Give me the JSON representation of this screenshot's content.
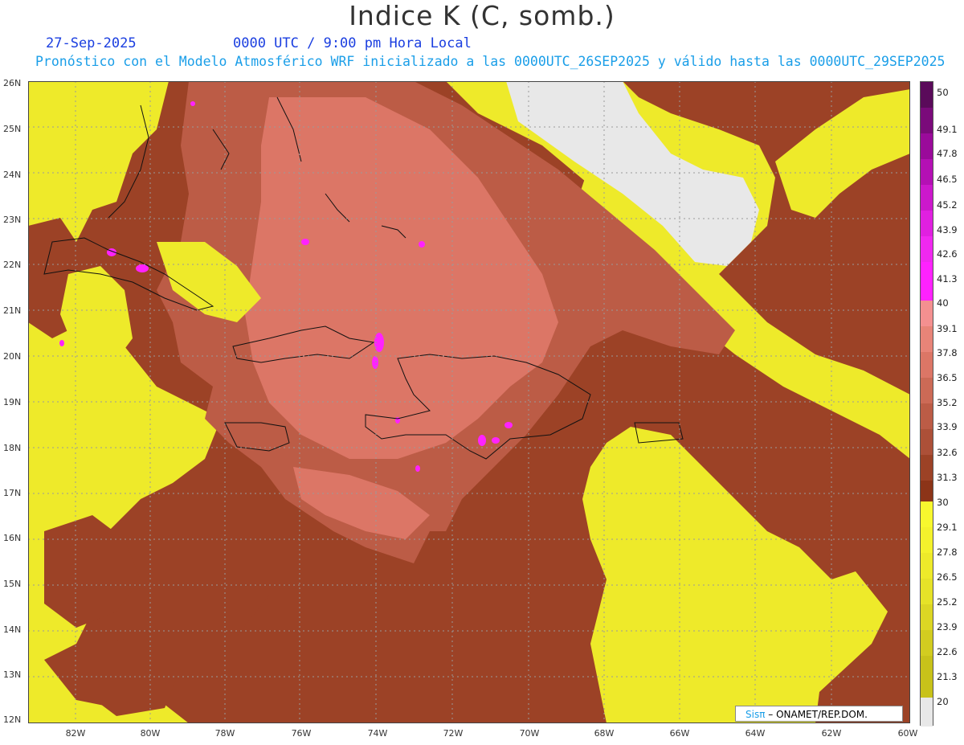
{
  "header": {
    "title": "Indice K (C, somb.)",
    "date": "27-Sep-2025",
    "time": "0000 UTC / 9:00 pm Hora Local",
    "subtitle": "Pronóstico con el Modelo Atmosférico WRF inicializado a las 0000UTC_26SEP2025 y válido hasta las  0000UTC_29SEP2025"
  },
  "colors": {
    "c20": "#e8e8e8",
    "c21": "#c8c21a",
    "c22": "#d2cc20",
    "c24": "#dcd624",
    "c25": "#e6e228",
    "c26": "#eeea2a",
    "c28": "#f4f22c",
    "c29": "#f8f82e",
    "c30": "#8c3418",
    "c31": "#9c4226",
    "c33": "#ac5038",
    "c34": "#bc5c46",
    "c35": "#cc6a56",
    "c36": "#dc7666",
    "c38": "#e88478",
    "c39": "#f49090",
    "magenta": "#ff22ff",
    "land_outline": "#111111",
    "grid": "#9a9a9a"
  },
  "colorbar": {
    "labels": [
      "50",
      "49.1",
      "47.8",
      "46.5",
      "45.2",
      "43.9",
      "42.6",
      "41.3",
      "40",
      "39.1",
      "37.8",
      "36.5",
      "35.2",
      "33.9",
      "32.6",
      "31.3",
      "30",
      "29.1",
      "27.8",
      "26.5",
      "25.2",
      "23.9",
      "22.6",
      "21.3",
      "20"
    ]
  },
  "axes": {
    "lat_labels": [
      "26N",
      "25N",
      "24N",
      "23N",
      "22N",
      "21N",
      "20N",
      "19N",
      "18N",
      "17N",
      "16N",
      "15N",
      "14N",
      "13N",
      "12N"
    ],
    "lon_labels": [
      "82W",
      "80W",
      "78W",
      "76W",
      "74W",
      "72W",
      "70W",
      "68W",
      "66W",
      "64W",
      "62W",
      "60W"
    ]
  },
  "credit": {
    "sis": "Sisπ",
    "org": " – ONAMET/REP.DOM."
  }
}
